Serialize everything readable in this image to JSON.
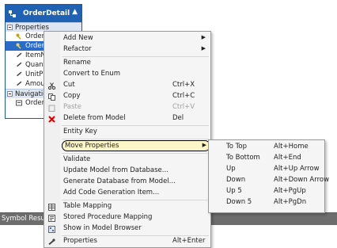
{
  "entity": {
    "name": "OrderDetail",
    "sections": {
      "properties": "Properties",
      "navigation": "Navigation"
    },
    "properties": [
      "OrderD",
      "OrderI",
      "ItemNa",
      "Quant",
      "UnitPr",
      "Amou"
    ],
    "navigation": [
      "OrderN"
    ]
  },
  "menu": {
    "items": [
      {
        "label": "Add New",
        "shortcut": "",
        "submenu": true,
        "icon": ""
      },
      {
        "label": "Refactor",
        "shortcut": "",
        "submenu": true,
        "icon": ""
      },
      {
        "label": "Rename",
        "shortcut": "",
        "icon": ""
      },
      {
        "label": "Convert to Enum",
        "shortcut": "",
        "icon": ""
      },
      {
        "label": "Cut",
        "shortcut": "Ctrl+X",
        "icon": "scissors-icon"
      },
      {
        "label": "Copy",
        "shortcut": "Ctrl+C",
        "icon": "copy-icon"
      },
      {
        "label": "Paste",
        "shortcut": "Ctrl+V",
        "icon": "paste-icon",
        "disabled": true
      },
      {
        "label": "Delete from Model",
        "shortcut": "Del",
        "icon": "delete-icon"
      },
      {
        "label": "Entity Key",
        "shortcut": "",
        "icon": ""
      },
      {
        "label": "Move Properties",
        "shortcut": "",
        "submenu": true,
        "highlighted": true
      },
      {
        "label": "Validate",
        "shortcut": "",
        "icon": ""
      },
      {
        "label": "Update Model from Database...",
        "shortcut": "",
        "icon": ""
      },
      {
        "label": "Generate Database from Model...",
        "shortcut": "",
        "icon": ""
      },
      {
        "label": "Add Code Generation Item...",
        "shortcut": "",
        "icon": ""
      },
      {
        "label": "Table Mapping",
        "shortcut": "",
        "icon": "table-mapping-icon"
      },
      {
        "label": "Stored Procedure Mapping",
        "shortcut": "",
        "icon": "stored-procedure-icon"
      },
      {
        "label": "Show in Model Browser",
        "shortcut": "",
        "icon": "model-browser-icon"
      },
      {
        "label": "Properties",
        "shortcut": "Alt+Enter",
        "icon": "wrench-icon"
      }
    ]
  },
  "submenu": {
    "items": [
      {
        "label": "To Top",
        "shortcut": "Alt+Home"
      },
      {
        "label": "To Bottom",
        "shortcut": "Alt+End"
      },
      {
        "label": "Up",
        "shortcut": "Alt+Up Arrow"
      },
      {
        "label": "Down",
        "shortcut": "Alt+Down Arrow"
      },
      {
        "label": "Up 5",
        "shortcut": "Alt+PgUp"
      },
      {
        "label": "Down 5",
        "shortcut": "Alt+PgDn"
      }
    ]
  },
  "panel": {
    "tab": "Symbol Results"
  },
  "colors": {
    "entity_header": "#1f62b4",
    "selection": "#2a6bc7",
    "highlight_fill": "#fdf6c8"
  }
}
